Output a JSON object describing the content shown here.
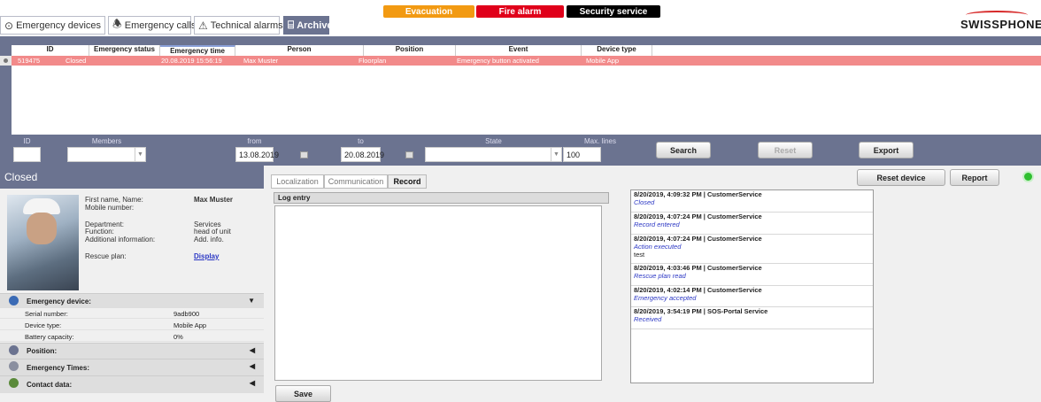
{
  "tabs": [
    {
      "label": "Emergency devices",
      "icon": "check-circle-icon"
    },
    {
      "label": "Emergency calls",
      "icon": "bell-icon"
    },
    {
      "label": "Technical alarms",
      "icon": "warning-triangle-icon"
    },
    {
      "label": "Archive",
      "icon": "archive-icon"
    }
  ],
  "alarms": [
    {
      "label": "Evacuation",
      "color": "#f29a12"
    },
    {
      "label": "Fire alarm",
      "color": "#e0001a"
    },
    {
      "label": "Security service",
      "color": "#000000"
    }
  ],
  "logo": "SWISSPHONE",
  "grid": {
    "headers": [
      "ID",
      "Emergency status",
      "Emergency time",
      "Person",
      "Position",
      "Event",
      "Device type"
    ],
    "row": [
      "519475",
      "Closed",
      "20.08.2019 15:56:19",
      "Max Muster",
      "Floorplan",
      "Emergency button activated",
      "Mobile App"
    ]
  },
  "filters": {
    "id_label": "ID",
    "members_label": "Members",
    "from_label": "from",
    "to_label": "to",
    "state_label": "State",
    "maxlines_label": "Max. lines",
    "from_value": "13.08.2019",
    "to_value": "20.08.2019",
    "maxlines_value": "100",
    "search": "Search",
    "reset": "Reset",
    "export": "Export"
  },
  "status": "Closed",
  "person": {
    "name_label": "First name, Name:",
    "name": "Max Muster",
    "mobile_label": "Mobile number:",
    "department_label": "Department:",
    "department": "Services",
    "function_label": "Function:",
    "function": "head of unit",
    "addinfo_label": "Additional information:",
    "addinfo": "Add. info.",
    "rescue_label": "Rescue plan:",
    "rescue_link": "Display"
  },
  "device": {
    "section": "Emergency device:",
    "serial_label": "Serial number:",
    "serial": "9adb900",
    "type_label": "Device type:",
    "type": "Mobile App",
    "battery_label": "Battery capacity:",
    "battery": "0%"
  },
  "sections": {
    "position": "Position:",
    "times": "Emergency Times:",
    "contact": "Contact data:"
  },
  "midtabs": [
    "Localization",
    "Communication",
    "Record"
  ],
  "log": {
    "header": "Log entry",
    "save": "Save"
  },
  "actions": {
    "reset_device": "Reset device",
    "report": "Report"
  },
  "record": [
    {
      "time": "8/20/2019, 4:09:32 PM | CustomerService",
      "status": "Closed",
      "note": ""
    },
    {
      "time": "8/20/2019, 4:07:24 PM | CustomerService",
      "status": "Record entered",
      "note": ""
    },
    {
      "time": "8/20/2019, 4:07:24 PM | CustomerService",
      "status": "Action executed",
      "note": "test"
    },
    {
      "time": "8/20/2019, 4:03:46 PM | CustomerService",
      "status": "Rescue plan read",
      "note": ""
    },
    {
      "time": "8/20/2019, 4:02:14 PM | CustomerService",
      "status": "Emergency accepted",
      "note": ""
    },
    {
      "time": "8/20/2019, 3:54:19 PM | SOS-Portal Service",
      "status": "Received",
      "note": ""
    }
  ],
  "colors": {
    "band": "#6b7390",
    "row_highlight": "#f28a8a",
    "link": "#2b37c4"
  }
}
